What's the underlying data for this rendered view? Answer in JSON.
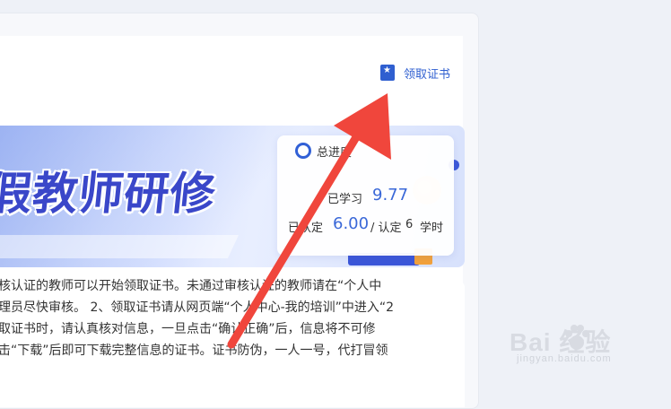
{
  "header": {
    "certificate_link": "领取证书",
    "certificate_icon": "certificate-star-icon"
  },
  "banner": {
    "title": "假教师研修"
  },
  "progress": {
    "title": "总进度",
    "studied_label": "已学习",
    "studied_value": "9.77",
    "certified_label": "已认定",
    "certified_value": "6.00",
    "separator": "/ 认定",
    "required_value": "6",
    "unit": "学时"
  },
  "notice": {
    "lines": [
      "核认证的教师可以开始领取证书。未通过审核认证的教师请在“个人中",
      "理员尽快审核。 2、领取证书请从网页端“个人中心-我的培训”中进入“2",
      "取证书时，请认真核对信息，一旦点击“确认正确”后，信息将不可修",
      "击“下载”后即可下载完整信息的证书。证书防伪，一人一号，代打冒领"
    ]
  },
  "colors": {
    "accent": "#2f5fd0",
    "arrow": "#f0463c",
    "value": "#3a68d8"
  },
  "watermark": {
    "brand": "Bai  经验",
    "url": "jingyan.baidu.com"
  }
}
